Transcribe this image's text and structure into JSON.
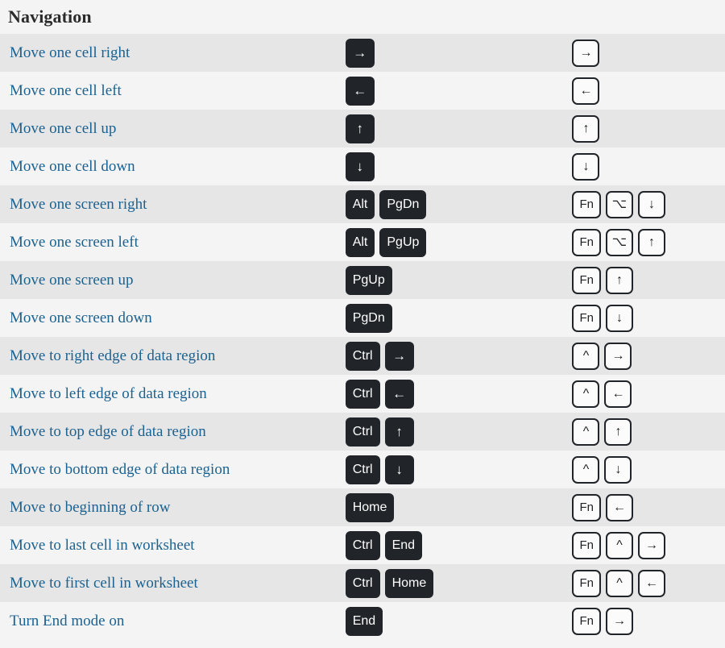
{
  "section": {
    "title": "Navigation"
  },
  "table": {
    "rows": [
      {
        "description": "Move one cell right",
        "windows_keys": [
          "→"
        ],
        "mac_keys": [
          "→"
        ],
        "striped": true
      },
      {
        "description": "Move one cell left",
        "windows_keys": [
          "←"
        ],
        "mac_keys": [
          "←"
        ],
        "striped": false
      },
      {
        "description": "Move one cell up",
        "windows_keys": [
          "↑"
        ],
        "mac_keys": [
          "↑"
        ],
        "striped": true
      },
      {
        "description": "Move one cell down",
        "windows_keys": [
          "↓"
        ],
        "mac_keys": [
          "↓"
        ],
        "striped": false
      },
      {
        "description": "Move one screen right",
        "windows_keys": [
          "Alt",
          "PgDn"
        ],
        "mac_keys": [
          "Fn",
          "⌥",
          "↓"
        ],
        "striped": true
      },
      {
        "description": "Move one screen left",
        "windows_keys": [
          "Alt",
          "PgUp"
        ],
        "mac_keys": [
          "Fn",
          "⌥",
          "↑"
        ],
        "striped": false
      },
      {
        "description": "Move one screen up",
        "windows_keys": [
          "PgUp"
        ],
        "mac_keys": [
          "Fn",
          "↑"
        ],
        "striped": true
      },
      {
        "description": "Move one screen down",
        "windows_keys": [
          "PgDn"
        ],
        "mac_keys": [
          "Fn",
          "↓"
        ],
        "striped": false
      },
      {
        "description": "Move to right edge of data region",
        "windows_keys": [
          "Ctrl",
          "→"
        ],
        "mac_keys": [
          "^",
          "→"
        ],
        "striped": true
      },
      {
        "description": "Move to left edge of data region",
        "windows_keys": [
          "Ctrl",
          "←"
        ],
        "mac_keys": [
          "^",
          "←"
        ],
        "striped": false
      },
      {
        "description": "Move to top edge of data region",
        "windows_keys": [
          "Ctrl",
          "↑"
        ],
        "mac_keys": [
          "^",
          "↑"
        ],
        "striped": true
      },
      {
        "description": "Move to bottom edge of data region",
        "windows_keys": [
          "Ctrl",
          "↓"
        ],
        "mac_keys": [
          "^",
          "↓"
        ],
        "striped": false
      },
      {
        "description": "Move to beginning of row",
        "windows_keys": [
          "Home"
        ],
        "mac_keys": [
          "Fn",
          "←"
        ],
        "striped": true
      },
      {
        "description": "Move to last cell in worksheet",
        "windows_keys": [
          "Ctrl",
          "End"
        ],
        "mac_keys": [
          "Fn",
          "^",
          "→"
        ],
        "striped": false
      },
      {
        "description": "Move to first cell in worksheet",
        "windows_keys": [
          "Ctrl",
          "Home"
        ],
        "mac_keys": [
          "Fn",
          "^",
          "←"
        ],
        "striped": true
      },
      {
        "description": "Turn End mode on",
        "windows_keys": [
          "End"
        ],
        "mac_keys": [
          "Fn",
          "→"
        ],
        "striped": false
      }
    ]
  },
  "colors": {
    "link": "#1c6291",
    "key_dark_bg": "#212529",
    "key_light_bg": "#fbfbfb",
    "row_striped_bg": "#e6e6e6",
    "row_plain_bg": "#f4f4f4",
    "heading": "#2b2b2b"
  }
}
